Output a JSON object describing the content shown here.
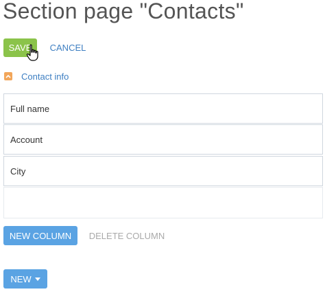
{
  "page": {
    "title": "Section page \"Contacts\""
  },
  "toolbar": {
    "save_label": "SAVE",
    "cancel_label": "CANCEL"
  },
  "section": {
    "label": "Contact info",
    "toggle_icon": "chevron-up-icon",
    "toggle_color": "#f2a65a"
  },
  "fields": [
    {
      "label": "Full name"
    },
    {
      "label": "Account"
    },
    {
      "label": "City"
    }
  ],
  "columns": {
    "new_label": "NEW COLUMN",
    "delete_label": "DELETE COLUMN"
  },
  "new_button": {
    "label": "NEW",
    "icon": "caret-down-icon"
  },
  "colors": {
    "save": "#8bc34a",
    "primary": "#5aa3e3",
    "link": "#3e7fc2",
    "disabled": "#a9a9a9"
  }
}
